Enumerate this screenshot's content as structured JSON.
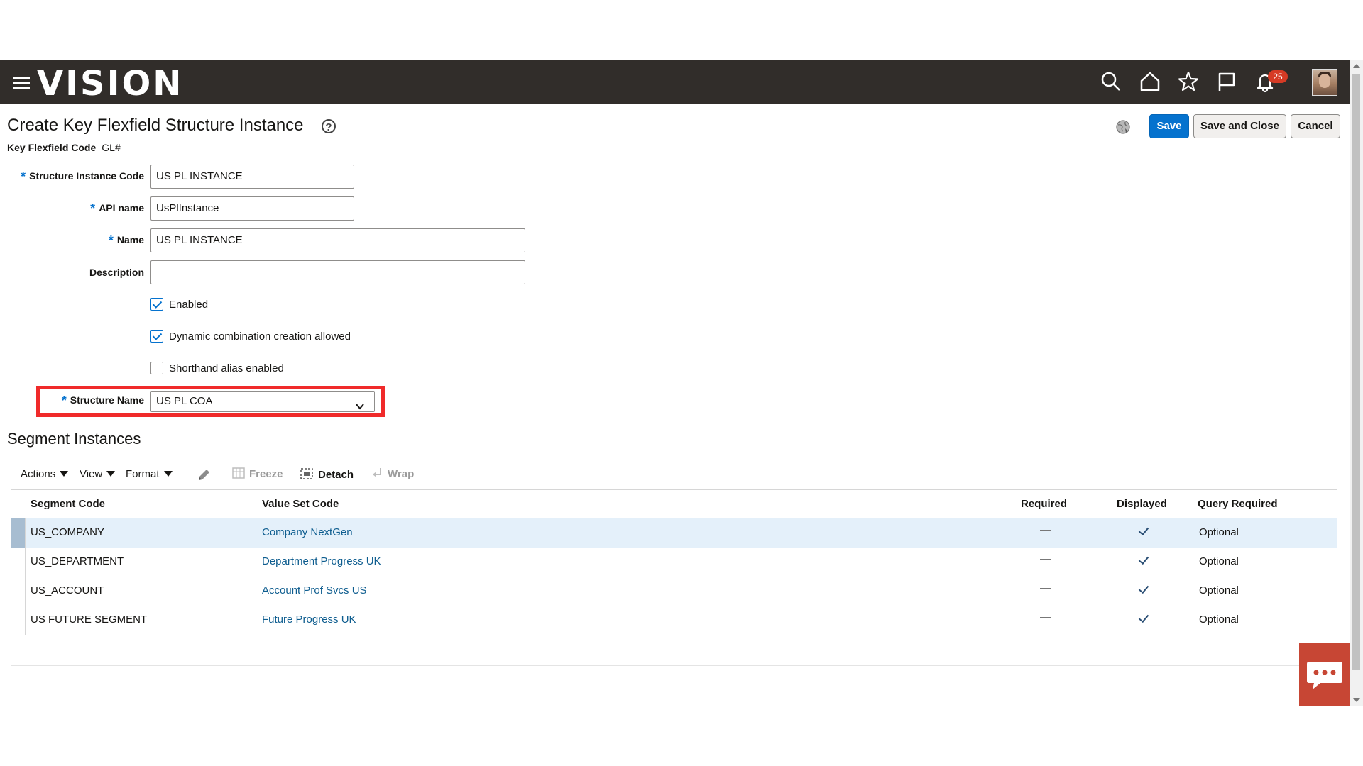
{
  "header": {
    "logo": "VISION",
    "notification_count": "25",
    "icons": [
      "menu-icon",
      "search-icon",
      "home-icon",
      "star-icon",
      "flag-icon",
      "bell-icon",
      "avatar"
    ]
  },
  "page": {
    "title": "Create Key Flexfield Structure Instance",
    "help_glyph": "?",
    "key_flexfield_code_label": "Key Flexfield Code",
    "key_flexfield_code_value": "GL#"
  },
  "buttons": {
    "save": "Save",
    "save_and_close": "Save and Close",
    "cancel": "Cancel"
  },
  "form": {
    "required_marker": "*",
    "structure_instance_code": {
      "label": "Structure Instance Code",
      "value": "US PL INSTANCE",
      "required": true
    },
    "api_name": {
      "label": "API name",
      "value": "UsPlInstance",
      "required": true
    },
    "name": {
      "label": "Name",
      "value": "US PL INSTANCE",
      "required": true
    },
    "description": {
      "label": "Description",
      "value": "",
      "required": false
    },
    "enabled": {
      "label": "Enabled",
      "checked": true
    },
    "dynamic_combination": {
      "label": "Dynamic combination creation allowed",
      "checked": true
    },
    "shorthand_alias": {
      "label": "Shorthand alias enabled",
      "checked": false
    },
    "structure_name": {
      "label": "Structure Name",
      "value": "US PL COA",
      "required": true
    }
  },
  "segments": {
    "title": "Segment Instances",
    "toolbar": {
      "actions": "Actions",
      "view": "View",
      "format": "Format",
      "freeze": "Freeze",
      "detach": "Detach",
      "wrap": "Wrap"
    },
    "columns": [
      "Segment Code",
      "Value Set Code",
      "Required",
      "Displayed",
      "Query Required"
    ],
    "rows": [
      {
        "segment_code": "US_COMPANY",
        "value_set_code": "Company NextGen",
        "required": false,
        "displayed": true,
        "query_required": "Optional",
        "selected": true
      },
      {
        "segment_code": "US_DEPARTMENT",
        "value_set_code": "Department Progress UK",
        "required": false,
        "displayed": true,
        "query_required": "Optional",
        "selected": false
      },
      {
        "segment_code": "US_ACCOUNT",
        "value_set_code": "Account Prof Svcs US",
        "required": false,
        "displayed": true,
        "query_required": "Optional",
        "selected": false
      },
      {
        "segment_code": "US FUTURE SEGMENT",
        "value_set_code": "Future Progress UK",
        "required": false,
        "displayed": true,
        "query_required": "Optional",
        "selected": false
      }
    ]
  },
  "colors": {
    "header_bg": "#312d2a",
    "primary_button": "#0572ce",
    "highlight_box": "#f02a2a",
    "chat_button": "#c74634"
  }
}
